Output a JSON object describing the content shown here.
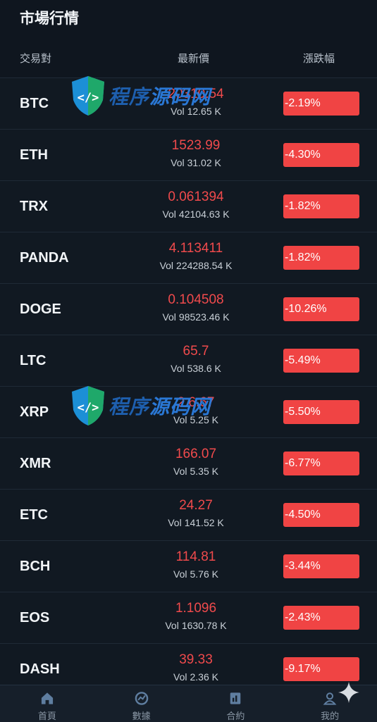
{
  "page": {
    "title": "市場行情"
  },
  "headers": {
    "pair": "交易對",
    "price": "最新價",
    "change": "漲跌幅"
  },
  "vol_label": "Vol",
  "rows": [
    {
      "symbol": "BTC",
      "price": "20310.54",
      "vol": "12.65 K",
      "change": "-2.19%"
    },
    {
      "symbol": "ETH",
      "price": "1523.99",
      "vol": "31.02 K",
      "change": "-4.30%"
    },
    {
      "symbol": "TRX",
      "price": "0.061394",
      "vol": "42104.63 K",
      "change": "-1.82%"
    },
    {
      "symbol": "PANDA",
      "price": "4.113411",
      "vol": "224288.54 K",
      "change": "-1.82%"
    },
    {
      "symbol": "DOGE",
      "price": "0.104508",
      "vol": "98523.46 K",
      "change": "-10.26%"
    },
    {
      "symbol": "LTC",
      "price": "65.7",
      "vol": "538.6 K",
      "change": "-5.49%"
    },
    {
      "symbol": "XRP",
      "price": "2.6.67",
      "vol": "5.25 K",
      "change": "-5.50%"
    },
    {
      "symbol": "XMR",
      "price": "166.07",
      "vol": "5.35 K",
      "change": "-6.77%"
    },
    {
      "symbol": "ETC",
      "price": "24.27",
      "vol": "141.52 K",
      "change": "-4.50%"
    },
    {
      "symbol": "BCH",
      "price": "114.81",
      "vol": "5.76 K",
      "change": "-3.44%"
    },
    {
      "symbol": "EOS",
      "price": "1.1096",
      "vol": "1630.78 K",
      "change": "-2.43%"
    },
    {
      "symbol": "DASH",
      "price": "39.33",
      "vol": "2.36 K",
      "change": "-9.17%"
    }
  ],
  "nav": [
    {
      "label": "首頁",
      "icon": "home-icon"
    },
    {
      "label": "數據",
      "icon": "chart-icon"
    },
    {
      "label": "合約",
      "icon": "contract-icon"
    },
    {
      "label": "我的",
      "icon": "user-icon"
    }
  ],
  "watermark": {
    "text_a": "程序",
    "text_b": "源码网"
  },
  "colors": {
    "background": "#0f161f",
    "down_red": "#f04444",
    "price_red": "#f04a4c"
  }
}
